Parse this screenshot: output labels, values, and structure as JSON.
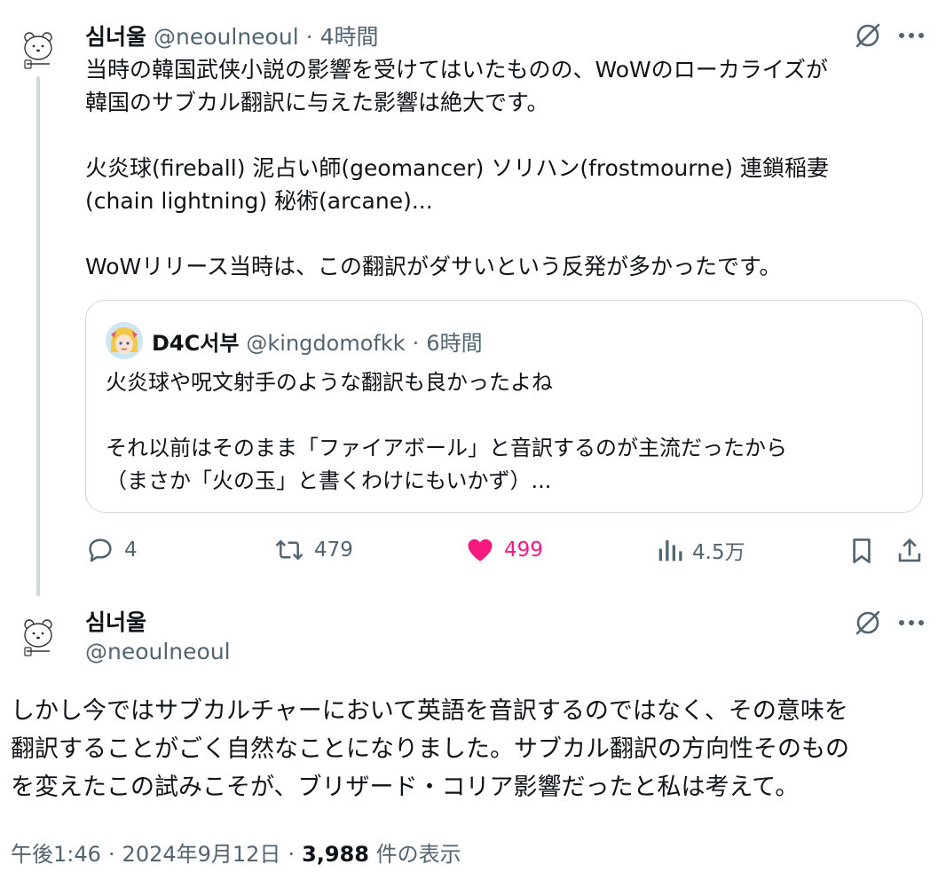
{
  "reply_tweet": {
    "display_name": "심너울",
    "handle": "@neoulneoul",
    "time": "4時間",
    "text": "当時の韓国武侠小説の影響を受けてはいたものの、WoWのローカライズが\n韓国のサブカル翻訳に与えた影響は絶大です。\n\n火炎球(fireball) 泥占い師(geomancer) ソリハン(frostmourne) 連鎖稲妻\n(chain lightning) 秘術(arcane)...\n\nWoWリリース当時は、この翻訳がダサいという反発が多かったです。",
    "quote": {
      "display_name": "D4C서부",
      "handle": "@kingdomofkk",
      "time": "6時間",
      "text": "火炎球や呪文射手のような翻訳も良かったよね\n\nそれ以前はそのまま「ファイアボール」と音訳するのが主流だったから\n（まさか「火の玉」と書くわけにもいかず）..."
    },
    "stats": {
      "replies": "4",
      "retweets": "479",
      "likes": "499",
      "views": "4.5万"
    },
    "icons": [
      "grok-icon",
      "more-icon",
      "reply-icon",
      "retweet-icon",
      "heart-icon",
      "views-icon",
      "bookmark-icon",
      "share-icon"
    ]
  },
  "main_tweet": {
    "display_name": "심너울",
    "handle": "@neoulneoul",
    "text": "しかし今ではサブカルチャーにおいて英語を音訳するのではなく、その意味を\n翻訳することがごく自然なことになりました。サブカル翻訳の方向性そのもの\nを変えたこの試みこそが、ブリザード・コリア影響だったと私は考えて。",
    "footer": {
      "time": "午後1:46",
      "date": "2024年9月12日",
      "view_count": "3,988",
      "view_label": "件の表示"
    }
  },
  "colors": {
    "text": "#0f1419",
    "secondary": "#536471",
    "border": "#cfd9de",
    "like": "#f91880"
  }
}
